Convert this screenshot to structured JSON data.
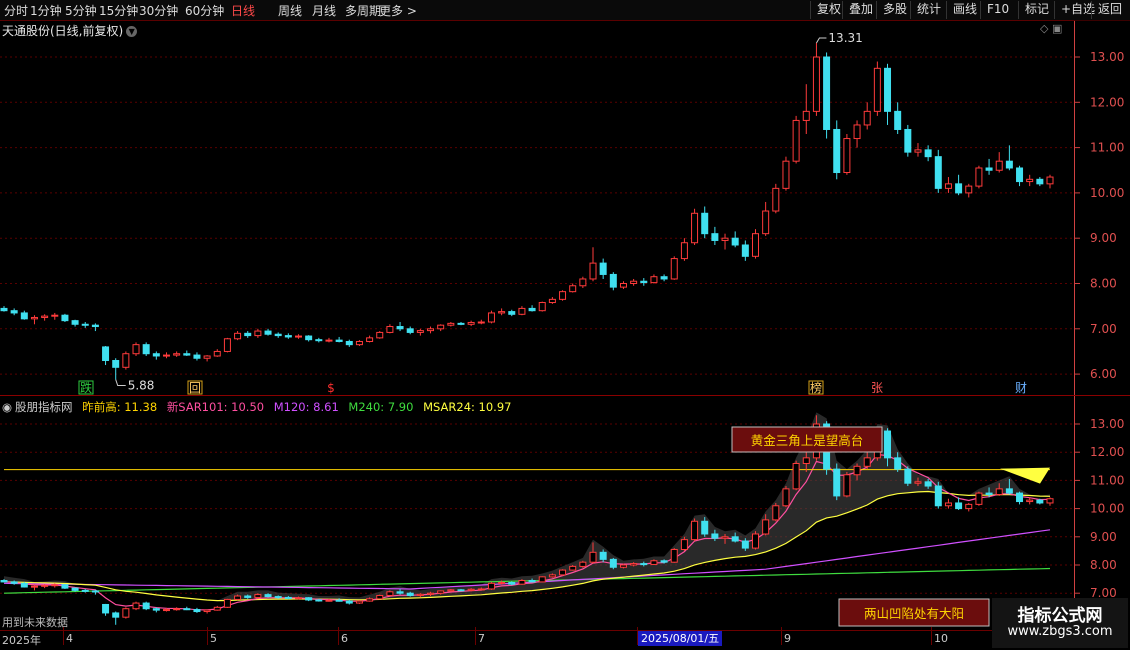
{
  "toolbar": {
    "periods": [
      "分时",
      "1分钟",
      "5分钟",
      "15分钟",
      "30分钟",
      "60分钟",
      "日线",
      "周线",
      "月线",
      "多周期",
      "更多 >"
    ],
    "active": "日线",
    "right": [
      "复权",
      "叠加",
      "多股",
      "统计",
      "画线",
      "F10",
      "标记",
      "+自选",
      "返回"
    ]
  },
  "main": {
    "title": "天通股份(日线,前复权)",
    "high_label": "13.31",
    "low_label": "5.88",
    "y_ticks": [
      "13.00",
      "12.00",
      "11.00",
      "10.00",
      "9.00",
      "8.00",
      "7.00",
      "6.00"
    ],
    "markers": [
      {
        "text": "跌",
        "color": "#2ecc40",
        "bg": "#2ecc40"
      },
      {
        "text": "回",
        "color": "#ffcc66",
        "bg": "#d4a017"
      },
      {
        "text": "$",
        "color": "#ff3030",
        "bg": ""
      },
      {
        "text": "榜",
        "color": "#ffcc66",
        "bg": "#d4a017"
      },
      {
        "text": "张",
        "color": "#ff5555",
        "bg": ""
      },
      {
        "text": "财",
        "color": "#6ab0ff",
        "bg": ""
      }
    ]
  },
  "indicator": {
    "name": "股朋指标网",
    "values": [
      {
        "label": "昨前高: 11.38",
        "color": "#ffd400"
      },
      {
        "label": "新SAR101: 10.50",
        "color": "#ff4fa0"
      },
      {
        "label": "M120: 8.61",
        "color": "#d050ff"
      },
      {
        "label": "M240: 7.90",
        "color": "#3fdc3f"
      },
      {
        "label": "MSAR24: 10.97",
        "color": "#ffff40"
      }
    ],
    "y_ticks": [
      "13.00",
      "12.00",
      "11.00",
      "10.00",
      "9.00",
      "8.00",
      "7.00"
    ],
    "box_top": "黄金三角上是望高台",
    "box_bottom": "两山凹陷处有大阳",
    "note": "用到未来数据"
  },
  "date_axis": {
    "labels": [
      "2025年",
      "4",
      "5",
      "6",
      "7",
      "8",
      "9",
      "10"
    ],
    "cursor": "2025/08/01/五"
  },
  "watermark": {
    "line1": "指标公式网",
    "line2": "www.zbgs3.com"
  },
  "colors": {
    "up": "#ff3b3b",
    "down": "#40e0f0",
    "grid": "#5a0000",
    "axis": "#d04040"
  },
  "chart_data": {
    "type": "candlestick",
    "title": "天通股份(日线,前复权)",
    "y_range": [
      5.6,
      13.5
    ],
    "ohlc": [
      [
        7.45,
        7.5,
        7.38,
        7.4
      ],
      [
        7.4,
        7.45,
        7.3,
        7.35
      ],
      [
        7.35,
        7.4,
        7.2,
        7.22
      ],
      [
        7.22,
        7.3,
        7.1,
        7.25
      ],
      [
        7.25,
        7.32,
        7.18,
        7.28
      ],
      [
        7.28,
        7.35,
        7.2,
        7.3
      ],
      [
        7.3,
        7.33,
        7.15,
        7.18
      ],
      [
        7.18,
        7.2,
        7.05,
        7.1
      ],
      [
        7.1,
        7.15,
        7.02,
        7.08
      ],
      [
        7.08,
        7.12,
        6.95,
        7.05
      ],
      [
        6.6,
        6.62,
        6.2,
        6.3
      ],
      [
        6.3,
        6.35,
        5.88,
        6.15
      ],
      [
        6.15,
        6.5,
        6.1,
        6.45
      ],
      [
        6.45,
        6.7,
        6.4,
        6.65
      ],
      [
        6.65,
        6.7,
        6.4,
        6.45
      ],
      [
        6.45,
        6.5,
        6.32,
        6.4
      ],
      [
        6.4,
        6.48,
        6.35,
        6.42
      ],
      [
        6.42,
        6.5,
        6.38,
        6.45
      ],
      [
        6.45,
        6.52,
        6.4,
        6.42
      ],
      [
        6.42,
        6.48,
        6.3,
        6.35
      ],
      [
        6.35,
        6.42,
        6.28,
        6.4
      ],
      [
        6.4,
        6.55,
        6.38,
        6.5
      ],
      [
        6.5,
        6.8,
        6.48,
        6.78
      ],
      [
        6.78,
        6.95,
        6.75,
        6.9
      ],
      [
        6.9,
        6.95,
        6.8,
        6.85
      ],
      [
        6.85,
        7.0,
        6.8,
        6.95
      ],
      [
        6.95,
        7.0,
        6.85,
        6.88
      ],
      [
        6.88,
        6.92,
        6.8,
        6.85
      ],
      [
        6.85,
        6.9,
        6.78,
        6.82
      ],
      [
        6.82,
        6.88,
        6.78,
        6.84
      ],
      [
        6.84,
        6.86,
        6.72,
        6.76
      ],
      [
        6.76,
        6.8,
        6.7,
        6.74
      ],
      [
        6.74,
        6.8,
        6.7,
        6.75
      ],
      [
        6.75,
        6.82,
        6.7,
        6.72
      ],
      [
        6.72,
        6.76,
        6.6,
        6.65
      ],
      [
        6.65,
        6.75,
        6.62,
        6.72
      ],
      [
        6.72,
        6.85,
        6.7,
        6.8
      ],
      [
        6.8,
        6.95,
        6.78,
        6.92
      ],
      [
        6.92,
        7.1,
        6.9,
        7.05
      ],
      [
        7.05,
        7.15,
        6.95,
        7.0
      ],
      [
        7.0,
        7.05,
        6.88,
        6.92
      ],
      [
        6.92,
        7.0,
        6.85,
        6.96
      ],
      [
        6.96,
        7.05,
        6.9,
        7.0
      ],
      [
        7.0,
        7.1,
        6.95,
        7.08
      ],
      [
        7.08,
        7.15,
        7.05,
        7.12
      ],
      [
        7.12,
        7.15,
        7.08,
        7.1
      ],
      [
        7.1,
        7.18,
        7.06,
        7.14
      ],
      [
        7.14,
        7.2,
        7.1,
        7.15
      ],
      [
        7.15,
        7.4,
        7.12,
        7.35
      ],
      [
        7.35,
        7.45,
        7.3,
        7.38
      ],
      [
        7.38,
        7.42,
        7.28,
        7.32
      ],
      [
        7.32,
        7.5,
        7.3,
        7.45
      ],
      [
        7.45,
        7.52,
        7.38,
        7.4
      ],
      [
        7.4,
        7.6,
        7.38,
        7.58
      ],
      [
        7.58,
        7.7,
        7.55,
        7.65
      ],
      [
        7.65,
        7.85,
        7.62,
        7.82
      ],
      [
        7.82,
        8.0,
        7.8,
        7.95
      ],
      [
        7.95,
        8.15,
        7.9,
        8.1
      ],
      [
        8.1,
        8.8,
        8.05,
        8.45
      ],
      [
        8.45,
        8.55,
        8.1,
        8.2
      ],
      [
        8.2,
        8.25,
        7.85,
        7.92
      ],
      [
        7.92,
        8.05,
        7.88,
        8.0
      ],
      [
        8.0,
        8.1,
        7.95,
        8.05
      ],
      [
        8.05,
        8.12,
        7.95,
        8.02
      ],
      [
        8.02,
        8.2,
        8.0,
        8.15
      ],
      [
        8.15,
        8.2,
        8.05,
        8.1
      ],
      [
        8.1,
        8.6,
        8.08,
        8.55
      ],
      [
        8.55,
        9.0,
        8.5,
        8.9
      ],
      [
        8.9,
        9.65,
        8.85,
        9.55
      ],
      [
        9.55,
        9.7,
        9.0,
        9.1
      ],
      [
        9.1,
        9.25,
        8.85,
        8.95
      ],
      [
        8.95,
        9.1,
        8.75,
        9.0
      ],
      [
        9.0,
        9.15,
        8.8,
        8.85
      ],
      [
        8.85,
        8.95,
        8.5,
        8.6
      ],
      [
        8.6,
        9.2,
        8.55,
        9.1
      ],
      [
        9.1,
        9.8,
        9.05,
        9.6
      ],
      [
        9.6,
        10.2,
        9.55,
        10.1
      ],
      [
        10.1,
        10.8,
        10.05,
        10.7
      ],
      [
        10.7,
        11.7,
        10.65,
        11.6
      ],
      [
        11.6,
        12.4,
        11.3,
        11.8
      ],
      [
        11.8,
        13.31,
        11.7,
        13.0
      ],
      [
        13.0,
        13.1,
        11.2,
        11.4
      ],
      [
        11.4,
        11.6,
        10.3,
        10.45
      ],
      [
        10.45,
        11.3,
        10.4,
        11.2
      ],
      [
        11.2,
        11.6,
        11.0,
        11.5
      ],
      [
        11.5,
        12.0,
        11.4,
        11.8
      ],
      [
        11.8,
        12.9,
        11.7,
        12.75
      ],
      [
        12.75,
        12.85,
        11.5,
        11.8
      ],
      [
        11.8,
        12.0,
        11.3,
        11.4
      ],
      [
        11.4,
        11.5,
        10.8,
        10.9
      ],
      [
        10.9,
        11.1,
        10.8,
        10.95
      ],
      [
        10.95,
        11.05,
        10.7,
        10.8
      ],
      [
        10.8,
        10.95,
        10.0,
        10.1
      ],
      [
        10.1,
        10.35,
        10.0,
        10.2
      ],
      [
        10.2,
        10.4,
        9.95,
        10.0
      ],
      [
        10.0,
        10.2,
        9.9,
        10.15
      ],
      [
        10.15,
        10.6,
        10.1,
        10.55
      ],
      [
        10.55,
        10.75,
        10.4,
        10.5
      ],
      [
        10.5,
        10.9,
        10.45,
        10.7
      ],
      [
        10.7,
        11.05,
        10.5,
        10.55
      ],
      [
        10.55,
        10.6,
        10.15,
        10.25
      ],
      [
        10.25,
        10.4,
        10.15,
        10.3
      ],
      [
        10.3,
        10.35,
        10.15,
        10.2
      ],
      [
        10.2,
        10.4,
        10.1,
        10.35
      ]
    ]
  }
}
